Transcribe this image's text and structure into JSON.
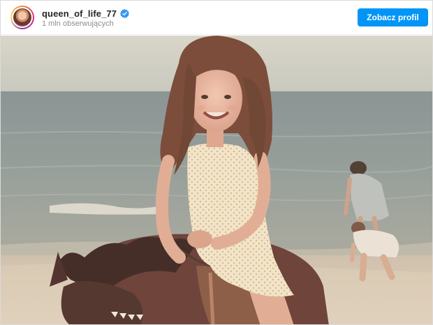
{
  "header": {
    "username": "queen_of_life_77",
    "followers": "1 mln obserwujących",
    "view_profile_label": "Zobacz profil",
    "verified_icon": "verified-badge-icon",
    "avatar_icon": "profile-avatar"
  },
  "post": {
    "image": "vintage-beach-photo-girl-on-pony"
  },
  "colors": {
    "accent": "#0095f6",
    "username": "#262626",
    "muted": "#8e8e8e"
  }
}
